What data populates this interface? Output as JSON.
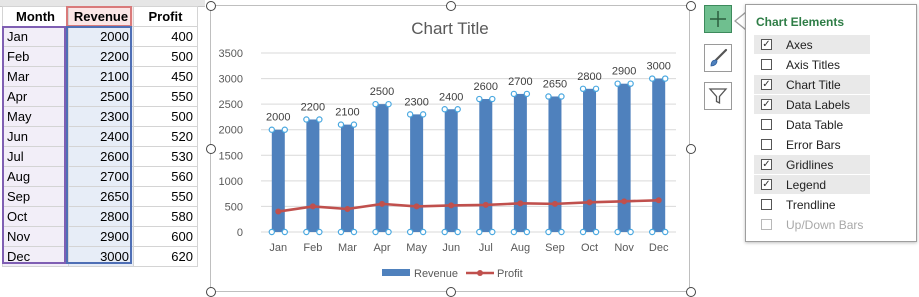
{
  "sheet": {
    "headers": [
      "Month",
      "Revenue",
      "Profit"
    ],
    "rows": [
      [
        "Jan",
        "2000",
        "400"
      ],
      [
        "Feb",
        "2200",
        "500"
      ],
      [
        "Mar",
        "2100",
        "450"
      ],
      [
        "Apr",
        "2500",
        "550"
      ],
      [
        "May",
        "2300",
        "500"
      ],
      [
        "Jun",
        "2400",
        "520"
      ],
      [
        "Jul",
        "2600",
        "530"
      ],
      [
        "Aug",
        "2700",
        "560"
      ],
      [
        "Sep",
        "2650",
        "550"
      ],
      [
        "Oct",
        "2800",
        "580"
      ],
      [
        "Nov",
        "2900",
        "600"
      ],
      [
        "Dec",
        "3000",
        "620"
      ]
    ]
  },
  "chart_data": {
    "type": "bar",
    "title": "Chart Title",
    "categories": [
      "Jan",
      "Feb",
      "Mar",
      "Apr",
      "May",
      "Jun",
      "Jul",
      "Aug",
      "Sep",
      "Oct",
      "Nov",
      "Dec"
    ],
    "series": [
      {
        "name": "Revenue",
        "kind": "bar",
        "color": "#4f81bd",
        "values": [
          2000,
          2200,
          2100,
          2500,
          2300,
          2400,
          2600,
          2700,
          2650,
          2800,
          2900,
          3000
        ]
      },
      {
        "name": "Profit",
        "kind": "line",
        "color": "#c0504d",
        "values": [
          400,
          500,
          450,
          550,
          500,
          520,
          530,
          560,
          550,
          580,
          600,
          620
        ]
      }
    ],
    "data_labels_series": "Revenue",
    "ylim": [
      0,
      3500
    ],
    "yticks": [
      0,
      500,
      1000,
      1500,
      2000,
      2500,
      3000,
      3500
    ],
    "grid": true,
    "legend": "bottom"
  },
  "side_buttons": {
    "elements_icon": "plus-icon",
    "styles_icon": "paintbrush-icon",
    "filters_icon": "funnel-icon"
  },
  "panel": {
    "title": "Chart Elements",
    "accent": "#2e7d46",
    "items": [
      {
        "label": "Axes",
        "checked": true,
        "disabled": false
      },
      {
        "label": "Axis Titles",
        "checked": false,
        "disabled": false
      },
      {
        "label": "Chart Title",
        "checked": true,
        "disabled": false
      },
      {
        "label": "Data Labels",
        "checked": true,
        "disabled": false
      },
      {
        "label": "Data Table",
        "checked": false,
        "disabled": false
      },
      {
        "label": "Error Bars",
        "checked": false,
        "disabled": false
      },
      {
        "label": "Gridlines",
        "checked": true,
        "disabled": false
      },
      {
        "label": "Legend",
        "checked": true,
        "disabled": false
      },
      {
        "label": "Trendline",
        "checked": false,
        "disabled": false
      },
      {
        "label": "Up/Down Bars",
        "checked": false,
        "disabled": true
      }
    ]
  }
}
